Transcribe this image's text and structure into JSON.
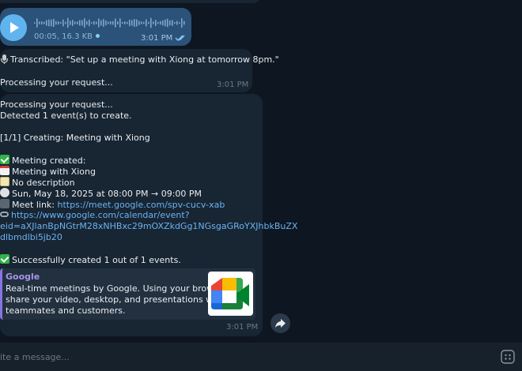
{
  "voice_message": {
    "meta": "00:05, 16.3 KB",
    "time": "3:01 PM"
  },
  "transcription": {
    "transcribed": "Transcribed: \"Set up a meeting with Xiong at tomorrow 8pm.\"",
    "processing": "Processing your request...",
    "time": "3:01 PM"
  },
  "result": {
    "processing": "Processing your request...",
    "detected": "Detected 1 event(s) to create.",
    "creating": "[1/1] Creating: Meeting with Xiong",
    "created": "Meeting created:",
    "title": "Meeting with Xiong",
    "description": "No description",
    "when": "Sun, May 18, 2025 at 08:00 PM → 09:00 PM",
    "meet_label": "Meet link: ",
    "meet_url": "https://meet.google.com/spv-cucv-xab",
    "calendar_url_1": "https://www.google.com/calendar/event?",
    "calendar_url_2": "eid=aXJlanBpNGtrM28xNHBxc29mOXZkdGg1NGsgaGRoYXJhbkBuZX",
    "calendar_url_3": "dlbmdlbi5jb20",
    "success": "Successfully created 1 out of 1 events.",
    "time": "3:01 PM"
  },
  "preview": {
    "site": "Google",
    "desc_1": "Real-time meetings by Google. Using your browser,",
    "desc_2": "share your video, desktop, and presentations with",
    "desc_3": "teammates and customers."
  },
  "composer": {
    "placeholder": "ite a message..."
  },
  "colors": {
    "background": "#0e1621",
    "incoming_bubble": "#182533",
    "outgoing_bubble": "#2b5278",
    "link": "#6ab3f3",
    "preview_accent": "#8774e1"
  },
  "icons": [
    "play-icon",
    "waveform",
    "read-checkmarks-icon",
    "microphone-icon",
    "check-mark-emoji",
    "calendar-emoji",
    "memo-emoji",
    "clock-emoji",
    "camera-emoji",
    "link-emoji",
    "google-meet-logo",
    "forward-icon",
    "sticker-icon"
  ]
}
